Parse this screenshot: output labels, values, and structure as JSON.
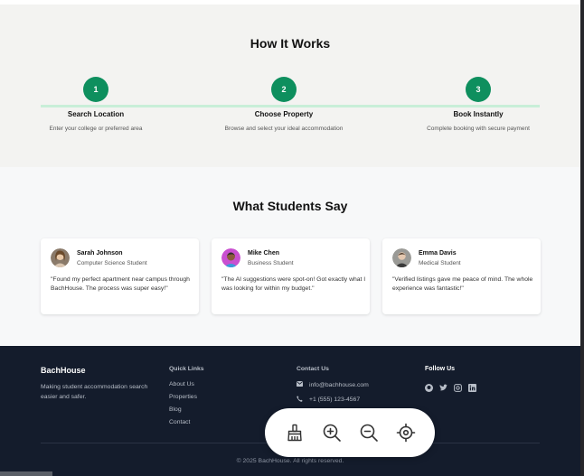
{
  "how_it_works": {
    "title": "How It Works",
    "steps": [
      {
        "number": "1",
        "title": "Search Location",
        "description": "Enter your college or preferred area"
      },
      {
        "number": "2",
        "title": "Choose Property",
        "description": "Browse and select your ideal accommodation"
      },
      {
        "number": "3",
        "title": "Book Instantly",
        "description": "Complete booking with secure payment"
      }
    ]
  },
  "testimonials": {
    "title": "What Students Say",
    "items": [
      {
        "name": "Sarah Johnson",
        "role": "Computer Science Student",
        "quote": "\"Found my perfect apartment near campus through BachHouse. The process was super easy!\""
      },
      {
        "name": "Mike Chen",
        "role": "Business Student",
        "quote": "\"The AI suggestions were spot-on! Got exactly what I was looking for within my budget.\""
      },
      {
        "name": "Emma Davis",
        "role": "Medical Student",
        "quote": "\"Verified listings gave me peace of mind. The whole experience was fantastic!\""
      }
    ]
  },
  "footer": {
    "brand": "BachHouse",
    "tagline": "Making student accommodation search easier and safer.",
    "quick_links_title": "Quick Links",
    "quick_links": [
      "About Us",
      "Properties",
      "Blog",
      "Contact"
    ],
    "contact_title": "Contact Us",
    "email": "info@bachhouse.com",
    "phone": "+1 (555) 123-4567",
    "follow_title": "Follow Us",
    "social_icons": [
      "github-icon",
      "twitter-icon",
      "instagram-icon",
      "linkedin-icon"
    ],
    "copyright": "© 2025 BachHouse. All rights reserved."
  },
  "toolbar": {
    "icons": [
      "broom-icon",
      "zoom-in-icon",
      "zoom-out-icon",
      "crosshair-icon"
    ]
  },
  "colors": {
    "accent": "#0e8f5e",
    "footer_bg": "#141c2c"
  }
}
